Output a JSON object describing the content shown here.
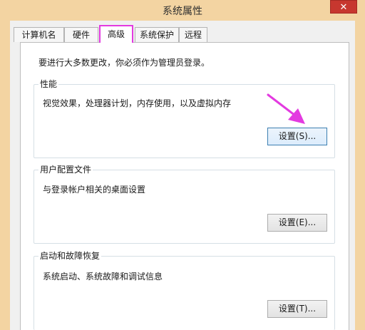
{
  "window": {
    "title": "系统属性",
    "close_glyph": "✕"
  },
  "tabs": [
    {
      "label": "计算机名"
    },
    {
      "label": "硬件"
    },
    {
      "label": "高级"
    },
    {
      "label": "系统保护"
    },
    {
      "label": "远程"
    }
  ],
  "active_tab": "高级",
  "notice": "要进行大多数更改，你必须作为管理员登录。",
  "groups": {
    "performance": {
      "title": "性能",
      "description": "视觉效果，处理器计划，内存使用，以及虚拟内存",
      "button": "设置(S)..."
    },
    "user_profiles": {
      "title": "用户配置文件",
      "description": "与登录帐户相关的桌面设置",
      "button": "设置(E)..."
    },
    "startup_recovery": {
      "title": "启动和故障恢复",
      "description": "系统启动、系统故障和调试信息",
      "button": "设置(T)..."
    }
  },
  "colors": {
    "highlight": "#e33ae0",
    "arrow": "#e33ae0",
    "close_button": "#c7372f",
    "frame": "#f3d4a2"
  }
}
